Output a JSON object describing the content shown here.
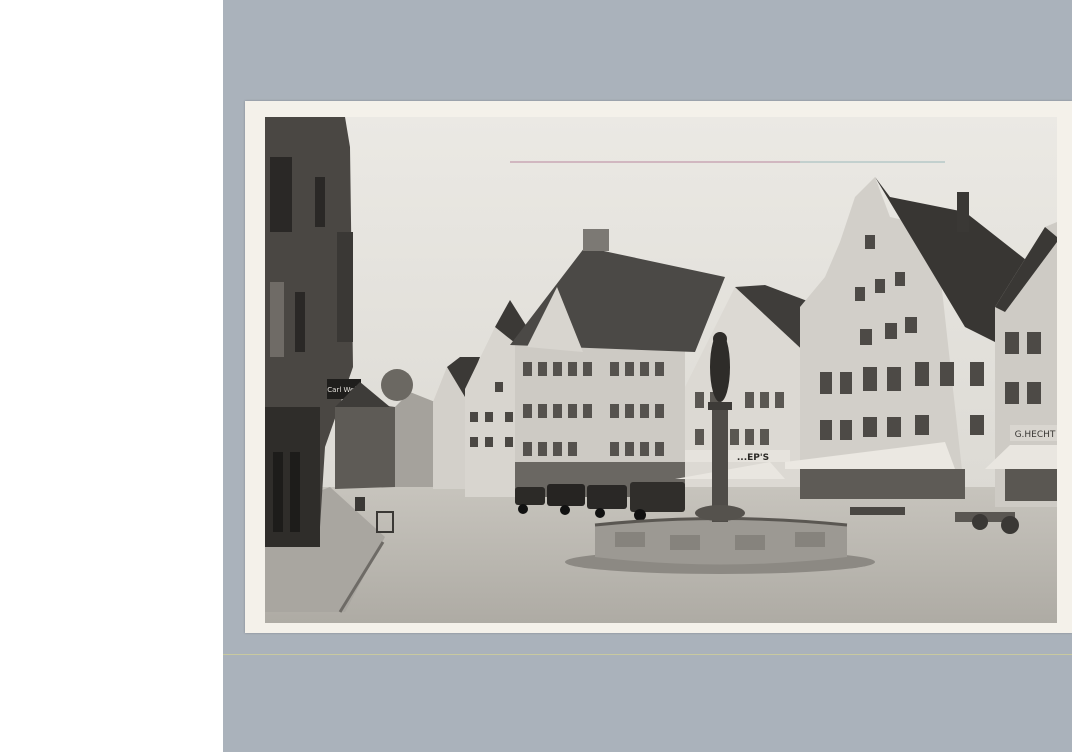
{
  "image": {
    "description_icon": "postcard-photo",
    "palette": {
      "scan_background": "#aab2bb",
      "card": "#f4f1ea",
      "sky": "#e6e4df",
      "pavement": "#b9b6af",
      "dark": "#2c2a27"
    }
  },
  "signs": {
    "hanging_sign": "Carl Weiß",
    "shop_left": "...EP'S",
    "shop_right": "G.HECHT"
  }
}
